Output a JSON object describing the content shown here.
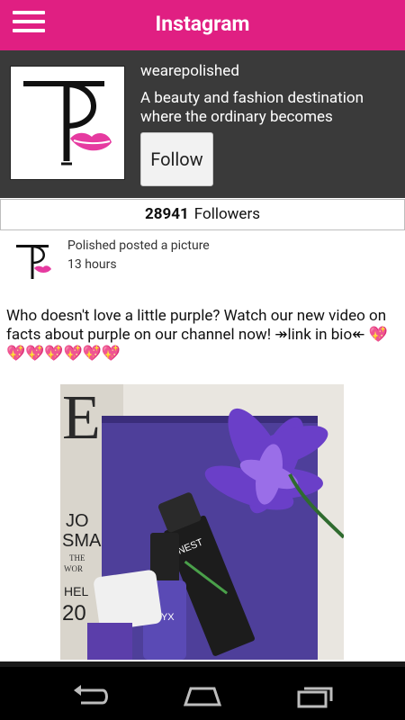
{
  "app": {
    "title": "Instagram"
  },
  "profile": {
    "username": "wearepolished",
    "bio": "A beauty and fashion destination where the ordinary becomes",
    "follow_label": "Follow",
    "followers_count": "28941",
    "followers_label": "Followers"
  },
  "post": {
    "action_text": "Polished posted a picture",
    "time": "13 hours",
    "caption_text": "Who doesn't love a little purple? Watch our new video on facts about purple on our channel now! ↠link in bio↞ ",
    "caption_hearts": "💖💖💖💖💖💖💖"
  },
  "colors": {
    "brand": "#e01f82",
    "profile_bg": "#3a3a3a"
  },
  "icons": {
    "menu": "hamburger-menu-icon",
    "back": "back-icon",
    "home": "home-icon",
    "recents": "recents-icon"
  }
}
